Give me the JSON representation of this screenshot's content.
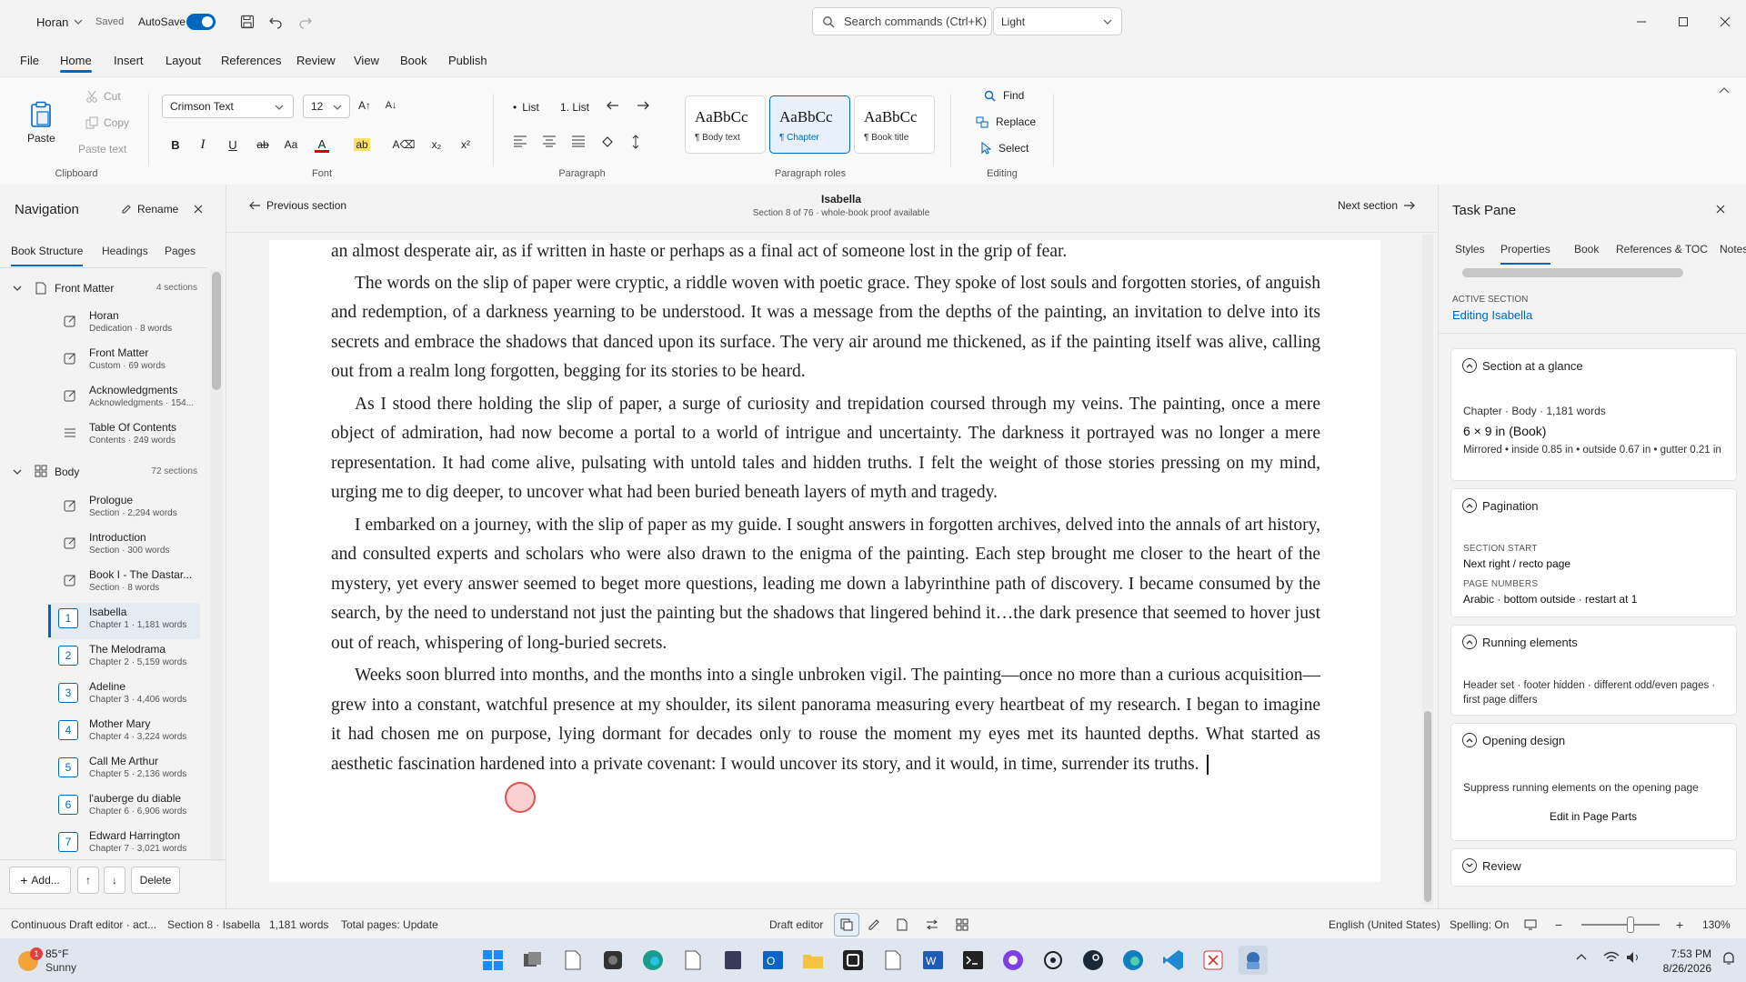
{
  "titlebar": {
    "doc_name": "Horan",
    "saved": "Saved",
    "autosave": "AutoSave",
    "search_placeholder": "Search commands (Ctrl+K)",
    "theme": "Light"
  },
  "menu": {
    "tabs": [
      "File",
      "Home",
      "Insert",
      "Layout",
      "References",
      "Review",
      "View",
      "Book",
      "Publish"
    ],
    "active": "Home"
  },
  "ribbon": {
    "clipboard": {
      "paste": "Paste",
      "cut": "Cut",
      "copy": "Copy",
      "paste_text": "Paste text",
      "label": "Clipboard"
    },
    "font": {
      "family": "Crimson Text",
      "size": "12",
      "label": "Font",
      "grow": "A↑",
      "shrink": "A↓"
    },
    "paragraph": {
      "bullet_list": "List",
      "numbered_list": "1. List",
      "label": "Paragraph"
    },
    "styles": [
      {
        "preview": "AaBbCc",
        "name": "¶ Body text"
      },
      {
        "preview": "AaBbCc",
        "name": "¶ Chapter"
      },
      {
        "preview": "AaBbCc",
        "name": "¶ Book title"
      }
    ],
    "styles_label": "Paragraph roles",
    "editing": {
      "find": "Find",
      "replace": "Replace",
      "select": "Select",
      "label": "Editing"
    }
  },
  "nav": {
    "title": "Navigation",
    "rename": "Rename",
    "tabs": [
      "Book Structure",
      "Headings",
      "Pages"
    ],
    "front_matter": {
      "label": "Front Matter",
      "count": "4 sections"
    },
    "front_items": [
      {
        "title": "Horan",
        "sub": "Dedication · 8 words"
      },
      {
        "title": "Front Matter",
        "sub": "Custom · 69 words"
      },
      {
        "title": "Acknowledgments",
        "sub": "Acknowledgments · 154..."
      },
      {
        "title": "Table Of Contents",
        "sub": "Contents · 249 words"
      }
    ],
    "body": {
      "label": "Body",
      "count": "72 sections"
    },
    "body_items": [
      {
        "title": "Prologue",
        "sub": "Section · 2,294 words"
      },
      {
        "title": "Introduction",
        "sub": "Section · 300 words"
      },
      {
        "title": "Book I - The Dastar...",
        "sub": "Section · 8 words"
      }
    ],
    "chapters": [
      {
        "num": "1",
        "title": "Isabella",
        "sub": "Chapter 1 · 1,181 words"
      },
      {
        "num": "2",
        "title": "The Melodrama",
        "sub": "Chapter 2 · 5,159 words"
      },
      {
        "num": "3",
        "title": "Adeline",
        "sub": "Chapter 3 · 4,406 words"
      },
      {
        "num": "4",
        "title": "Mother Mary",
        "sub": "Chapter 4 · 3,224 words"
      },
      {
        "num": "5",
        "title": "Call Me Arthur",
        "sub": "Chapter 5 · 2,136 words"
      },
      {
        "num": "6",
        "title": "l'auberge du diable",
        "sub": "Chapter 6 · 6,906 words"
      },
      {
        "num": "7",
        "title": "Edward Harrington",
        "sub": "Chapter 7 · 3,021 words"
      }
    ],
    "add": "Add...",
    "up": "↑",
    "down": "↓",
    "delete": "Delete"
  },
  "editor": {
    "prev": "Previous section",
    "next": "Next section",
    "section_title": "Isabella",
    "section_sub": "Section 8 of 76 · whole-book proof available",
    "paragraphs": [
      "an almost desperate air, as if written in haste or perhaps as a final act of someone lost in the grip of fear.",
      "The words on the slip of paper were cryptic, a riddle woven with poetic grace. They spoke of lost souls and forgotten stories, of anguish and redemption, of a darkness yearning to be understood. It was a message from the depths of the painting, an invitation to delve into its secrets and embrace the shadows that danced upon its surface. The very air around me thickened, as if the painting itself was alive, calling out from a realm long forgotten, begging for its stories to be heard.",
      "As I stood there holding the slip of paper, a surge of curiosity and trepidation coursed through my veins. The painting, once a mere object of admiration, had now become a portal to a world of intrigue and uncertainty. The darkness it portrayed was no longer a mere representation. It had come alive, pulsating with untold tales and hidden truths. I felt the weight of those stories pressing on my mind, urging me to dig deeper, to uncover what had been buried beneath layers of myth and tragedy.",
      "I embarked on a journey, with the slip of paper as my guide. I sought answers in forgotten archives, delved into the annals of art history, and consulted experts and scholars who were also drawn to the enigma of the painting. Each step brought me closer to the heart of the mystery, yet every answer seemed to beget more questions, leading me down a labyrinthine path of discovery. I became consumed by the search, by the need to understand not just the painting but the shadows that lingered behind it…the dark presence that seemed to hover just out of reach, whispering of long-buried secrets.",
      "Weeks soon blurred into months, and the months into a single unbroken vigil. The painting—once no more than a curious acquisition—grew into a constant, watchful presence at my shoulder, its silent panorama measuring every heartbeat of my research. I began to imagine it had chosen me on purpose, lying dormant for decades only to rouse the moment my eyes met its haunted depths. What started as aesthetic fascination hardened into a private covenant: I would uncover its story, and it would, in time, surrender its truths."
    ]
  },
  "taskpane": {
    "title": "Task Pane",
    "tabs": [
      "Styles",
      "Properties",
      "Book",
      "References & TOC",
      "Notes"
    ],
    "active_section_label": "ACTIVE SECTION",
    "active_section": "Editing Isabella",
    "glance": {
      "title": "Section at a glance",
      "line1": "Chapter · Body · 1,181 words",
      "line2": "6 × 9 in (Book)",
      "line3": "Mirrored • inside 0.85 in • outside 0.67 in • gutter 0.21 in"
    },
    "pagination": {
      "title": "Pagination",
      "start_label": "SECTION START",
      "start": "Next right / recto page",
      "numbers_label": "PAGE NUMBERS",
      "numbers": "Arabic · bottom outside · restart at 1"
    },
    "running": {
      "title": "Running elements",
      "text": "Header set · footer hidden · different odd/even pages · first page differs"
    },
    "opening": {
      "title": "Opening design",
      "text": "Suppress running elements on the opening page",
      "link": "Edit in Page Parts"
    },
    "review": {
      "title": "Review"
    }
  },
  "status": {
    "mode": "Continuous Draft editor · act...",
    "section": "Section 8 · Isabella",
    "words": "1,181 words",
    "pages": "Total pages: Update",
    "editor": "Draft editor",
    "language": "English (United States)",
    "spelling": "Spelling: On",
    "zoom": "130%"
  },
  "taskbar": {
    "weather_temp": "85°F",
    "weather_desc": "Sunny",
    "weather_badge": "1",
    "time": "7:53 PM",
    "date": "8/26/2026"
  },
  "colors": {
    "accent": "#0067c0",
    "cursor_marker": "#e05050"
  }
}
